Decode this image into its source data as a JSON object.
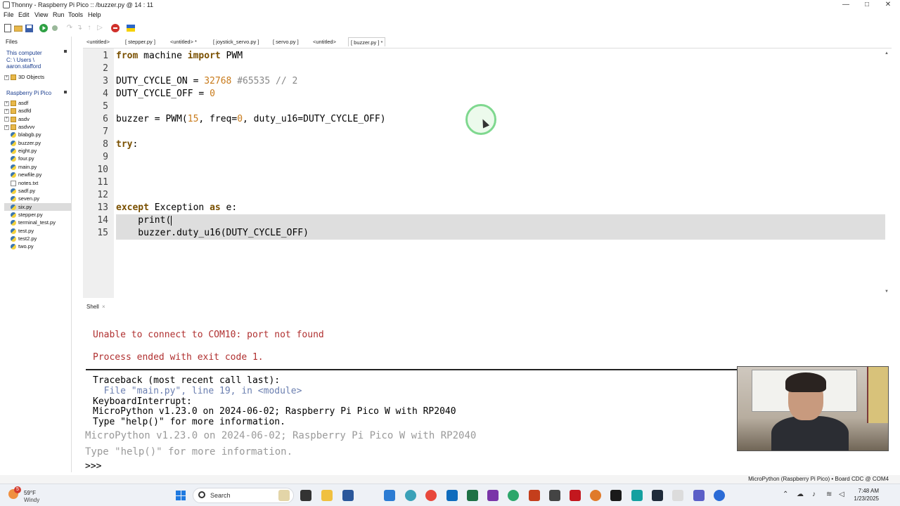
{
  "window": {
    "title": "Thonny  -  Raspberry Pi Pico :: /buzzer.py  @  14 : 11",
    "minimize": "—",
    "maximize": "□",
    "close": "✕"
  },
  "menu": [
    "File",
    "Edit",
    "View",
    "Run",
    "Tools",
    "Help"
  ],
  "files": {
    "tab": "Files",
    "this_computer": "This computer",
    "path_1": "C: \\ Users \\",
    "path_2": "aaron.stafford",
    "local_items": [
      {
        "name": "3D Objects",
        "kind": "folder"
      }
    ],
    "pico_header": "Raspberry Pi Pico",
    "pico_items": [
      {
        "name": "asdf",
        "kind": "folder"
      },
      {
        "name": "asdfd",
        "kind": "folder"
      },
      {
        "name": "asdv",
        "kind": "folder"
      },
      {
        "name": "asdvvv",
        "kind": "folder"
      },
      {
        "name": "blabgb.py",
        "kind": "py"
      },
      {
        "name": "buzzer.py",
        "kind": "py"
      },
      {
        "name": "eight.py",
        "kind": "py"
      },
      {
        "name": "four.py",
        "kind": "py"
      },
      {
        "name": "main.py",
        "kind": "py"
      },
      {
        "name": "newfile.py",
        "kind": "py"
      },
      {
        "name": "notes.txt",
        "kind": "txt"
      },
      {
        "name": "sadf.py",
        "kind": "py"
      },
      {
        "name": "seven.py",
        "kind": "py"
      },
      {
        "name": "six.py",
        "kind": "py"
      },
      {
        "name": "stepper.py",
        "kind": "py"
      },
      {
        "name": "terminal_test.py",
        "kind": "py"
      },
      {
        "name": "test.py",
        "kind": "py"
      },
      {
        "name": "test2.py",
        "kind": "py"
      },
      {
        "name": "two.py",
        "kind": "py"
      }
    ]
  },
  "tabs": [
    "<untitled>",
    "[ stepper.py ]",
    "<untitled> *",
    "[ joystick_servo.py ]",
    "[ servo.py ]",
    "<untitled>",
    "[ buzzer.py ] *"
  ],
  "active_tab": "[ buzzer.py ] *",
  "editor": {
    "line_numbers": [
      "1",
      "2",
      "3",
      "4",
      "5",
      "6",
      "7",
      "8",
      "9",
      "10",
      "11",
      "12",
      "13",
      "14",
      "15"
    ],
    "lines": [
      {
        "kw": "from",
        "t1": " machine ",
        "kw2": "import",
        "t2": " PWM"
      },
      {},
      {
        "t1": "DUTY_CYCLE_ON = ",
        "num": "32768",
        "cmt": " #65535 // 2"
      },
      {
        "t1": "DUTY_CYCLE_OFF = ",
        "num": "0"
      },
      {},
      {
        "t1": "buzzer = PWM(",
        "num": "15",
        "t2": ", freq=",
        "num2": "0",
        "t3": ", duty_u16=DUTY_CYCLE_OFF)"
      },
      {},
      {
        "kw": "try",
        "t1": ":"
      },
      {},
      {},
      {},
      {},
      {
        "kw": "except",
        "t1": " Exception ",
        "kw2": "as",
        "t2": " e:"
      },
      {
        "t1": "    print("
      },
      {
        "t1": "    buzzer.duty_u16(DUTY_CYCLE_OFF)"
      }
    ]
  },
  "shell": {
    "tab": "Shell",
    "error_line": "Unable to connect to COM10: port not found",
    "exit_line": "Process ended with exit code 1.",
    "traceback": "Traceback (most recent call last):",
    "file_line": "  File \"main.py\", line 19, in <module>",
    "interrupt": "KeyboardInterrupt:",
    "version": "MicroPython v1.23.0 on 2024-06-02; Raspberry Pi Pico W with RP2040",
    "help": "Type \"help()\" for more information.",
    "version_faint": "MicroPython v1.23.0 on 2024-06-02; Raspberry Pi Pico W with RP2040",
    "help_faint": "Type \"help()\" for more information.",
    "prompt": ">>>"
  },
  "status": "MicroPython (Raspberry Pi Pico)  •  Board CDC @ COM4",
  "taskbar": {
    "weather_badge": "5",
    "temp": "59°F",
    "condition": "Windy",
    "search": "Search",
    "time": "7:48 AM",
    "date": "1/23/2025"
  },
  "colors": {
    "keyword": "#7a5000",
    "number": "#c87a1a",
    "comment": "#888888",
    "error": "#b03030",
    "gutter": "#efefef",
    "highlight": "#dedede"
  }
}
